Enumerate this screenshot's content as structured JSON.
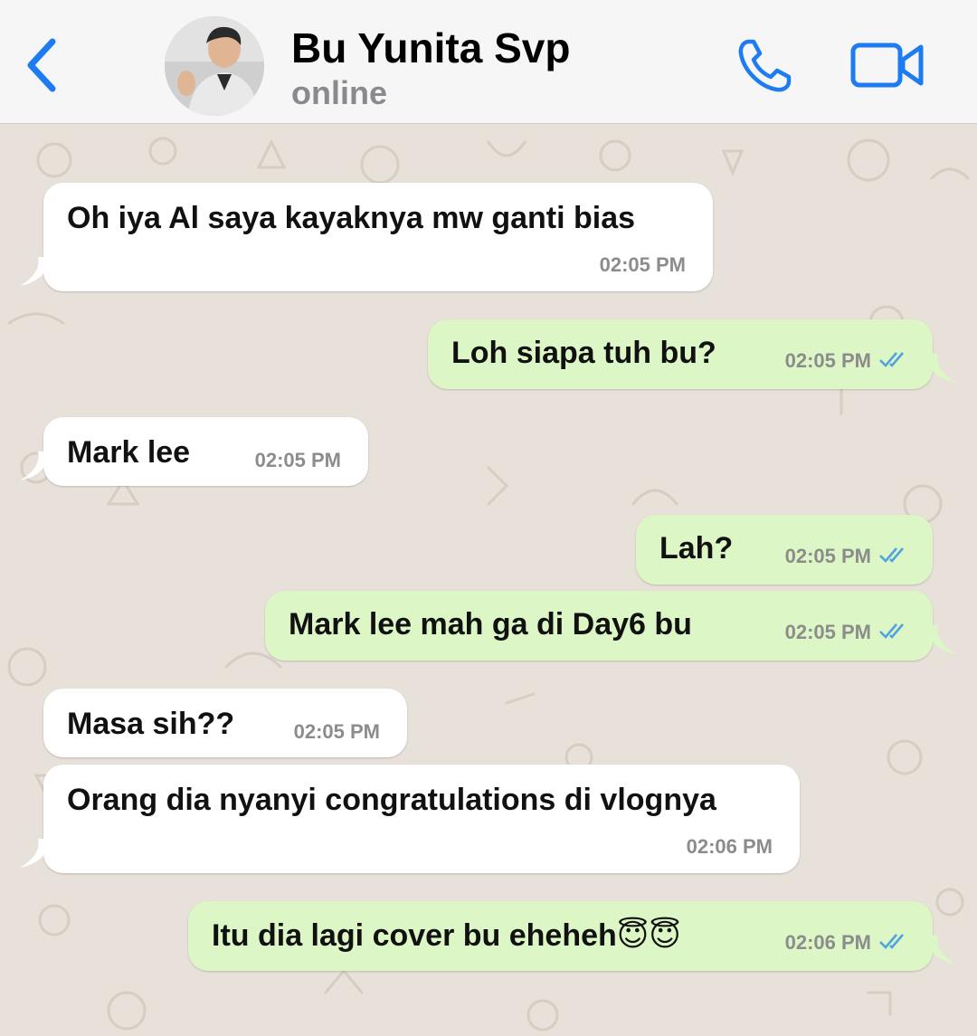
{
  "header": {
    "contact_name": "Bu Yunita Svp",
    "status": "online"
  },
  "colors": {
    "accent": "#1d7cf2",
    "incoming_bubble": "#ffffff",
    "outgoing_bubble": "#dcf7c5",
    "read_ticks": "#4fa3e0",
    "chat_background": "#e8e1d9"
  },
  "icons": {
    "back": "chevron-left-icon",
    "call": "phone-icon",
    "video": "video-camera-icon",
    "read": "double-check-icon"
  },
  "messages": [
    {
      "direction": "incoming",
      "text": "Oh iya Al saya kayaknya mw ganti bias",
      "time": "02:05 PM"
    },
    {
      "direction": "outgoing",
      "text": "Loh siapa tuh bu?",
      "time": "02:05 PM",
      "read": true
    },
    {
      "direction": "incoming",
      "text": "Mark lee",
      "time": "02:05 PM"
    },
    {
      "direction": "outgoing",
      "text": "Lah?",
      "time": "02:05 PM",
      "read": true
    },
    {
      "direction": "outgoing",
      "text": "Mark lee mah ga di Day6 bu",
      "time": "02:05 PM",
      "read": true
    },
    {
      "direction": "incoming",
      "text": "Masa sih??",
      "time": "02:05 PM"
    },
    {
      "direction": "incoming",
      "text": "Orang dia nyanyi congratulations di vlognya",
      "time": "02:06 PM"
    },
    {
      "direction": "outgoing",
      "text": "Itu dia lagi cover bu eheheh😇😇",
      "time": "02:06 PM",
      "read": true
    }
  ]
}
